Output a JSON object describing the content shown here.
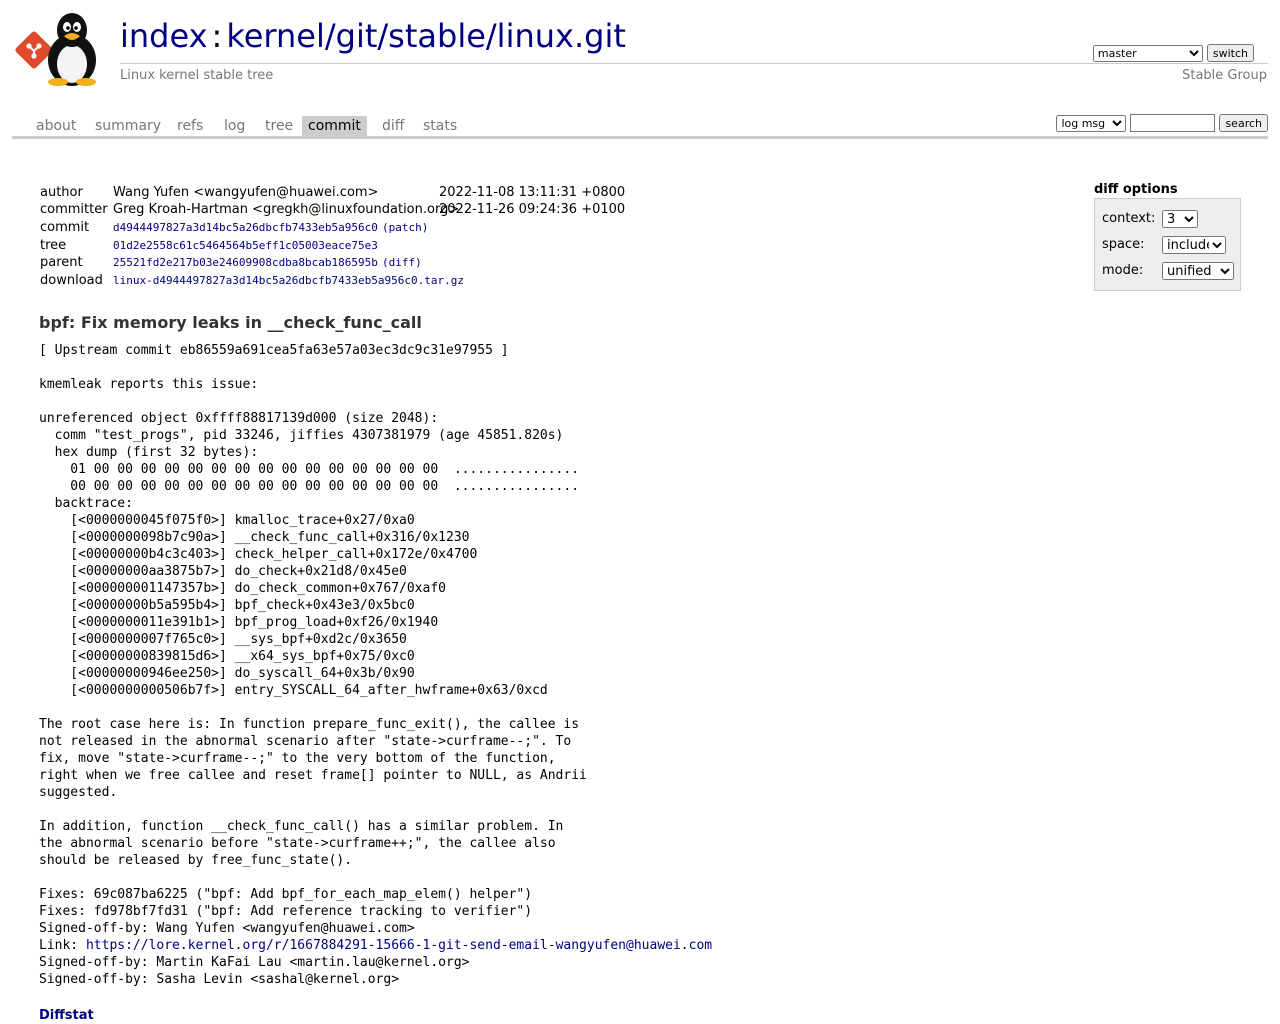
{
  "header": {
    "title_index": "index",
    "title_sep": ":",
    "title_repo": "kernel/git/stable/linux.git",
    "description": "Linux kernel stable tree",
    "owner": "Stable Group",
    "branch_selected": "master",
    "switch_label": "switch"
  },
  "tabs": [
    {
      "label": "about"
    },
    {
      "label": "summary"
    },
    {
      "label": "refs"
    },
    {
      "label": "log"
    },
    {
      "label": "tree"
    },
    {
      "label": "commit",
      "active": true
    },
    {
      "label": "diff"
    },
    {
      "label": "stats"
    }
  ],
  "search": {
    "mode_selected": "log msg",
    "query": "",
    "button_label": "search"
  },
  "commit_info": {
    "author_label": "author",
    "author": "Wang Yufen <wangyufen@huawei.com>",
    "author_date": "2022-11-08 13:11:31 +0800",
    "committer_label": "committer",
    "committer": "Greg Kroah-Hartman <gregkh@linuxfoundation.org>",
    "committer_date": "2022-11-26 09:24:36 +0100",
    "commit_label": "commit",
    "commit_hash": "d4944497827a3d14bc5a26dbcfb7433eb5a956c0",
    "commit_extra": "(patch)",
    "tree_label": "tree",
    "tree_hash": "01d2e2558c61c5464564b5eff1c05003eace75e3",
    "parent_label": "parent",
    "parent_hash": "25521fd2e217b03e24609908cdba8bcab186595b",
    "parent_extra": "(diff)",
    "download_label": "download",
    "download_file": "linux-d4944497827a3d14bc5a26dbcfb7433eb5a956c0.tar.gz"
  },
  "diff_options": {
    "title": "diff options",
    "context_label": "context:",
    "context_value": "3",
    "space_label": "space:",
    "space_value": "include",
    "mode_label": "mode:",
    "mode_value": "unified"
  },
  "subject": "bpf: Fix memory leaks in __check_func_call",
  "message_body": "[ Upstream commit eb86559a691cea5fa63e57a03ec3dc9c31e97955 ]\n\nkmemleak reports this issue:\n\nunreferenced object 0xffff88817139d000 (size 2048):\n  comm \"test_progs\", pid 33246, jiffies 4307381979 (age 45851.820s)\n  hex dump (first 32 bytes):\n    01 00 00 00 00 00 00 00 00 00 00 00 00 00 00 00  ................\n    00 00 00 00 00 00 00 00 00 00 00 00 00 00 00 00  ................\n  backtrace:\n    [<0000000045f075f0>] kmalloc_trace+0x27/0xa0\n    [<0000000098b7c90a>] __check_func_call+0x316/0x1230\n    [<00000000b4c3c403>] check_helper_call+0x172e/0x4700\n    [<00000000aa3875b7>] do_check+0x21d8/0x45e0\n    [<000000001147357b>] do_check_common+0x767/0xaf0\n    [<00000000b5a595b4>] bpf_check+0x43e3/0x5bc0\n    [<0000000011e391b1>] bpf_prog_load+0xf26/0x1940\n    [<0000000007f765c0>] __sys_bpf+0xd2c/0x3650\n    [<00000000839815d6>] __x64_sys_bpf+0x75/0xc0\n    [<00000000946ee250>] do_syscall_64+0x3b/0x90\n    [<0000000000506b7f>] entry_SYSCALL_64_after_hwframe+0x63/0xcd\n\nThe root case here is: In function prepare_func_exit(), the callee is\nnot released in the abnormal scenario after \"state->curframe--;\". To\nfix, move \"state->curframe--;\" to the very bottom of the function,\nright when we free callee and reset frame[] pointer to NULL, as Andrii\nsuggested.\n\nIn addition, function __check_func_call() has a similar problem. In\nthe abnormal scenario before \"state->curframe++;\", the callee also\nshould be released by free_func_state().\n\nFixes: 69c087ba6225 (\"bpf: Add bpf_for_each_map_elem() helper\")\nFixes: fd978bf7fd31 (\"bpf: Add reference tracking to verifier\")\nSigned-off-by: Wang Yufen <wangyufen@huawei.com>\nLink: ",
  "message_link": "https://lore.kernel.org/r/1667884291-15666-1-git-send-email-wangyufen@huawei.com",
  "message_tail": "\nSigned-off-by: Martin KaFai Lau <martin.lau@kernel.org>\nSigned-off-by: Sasha Levin <sashal@kernel.org>",
  "diffstat_label": "Diffstat"
}
